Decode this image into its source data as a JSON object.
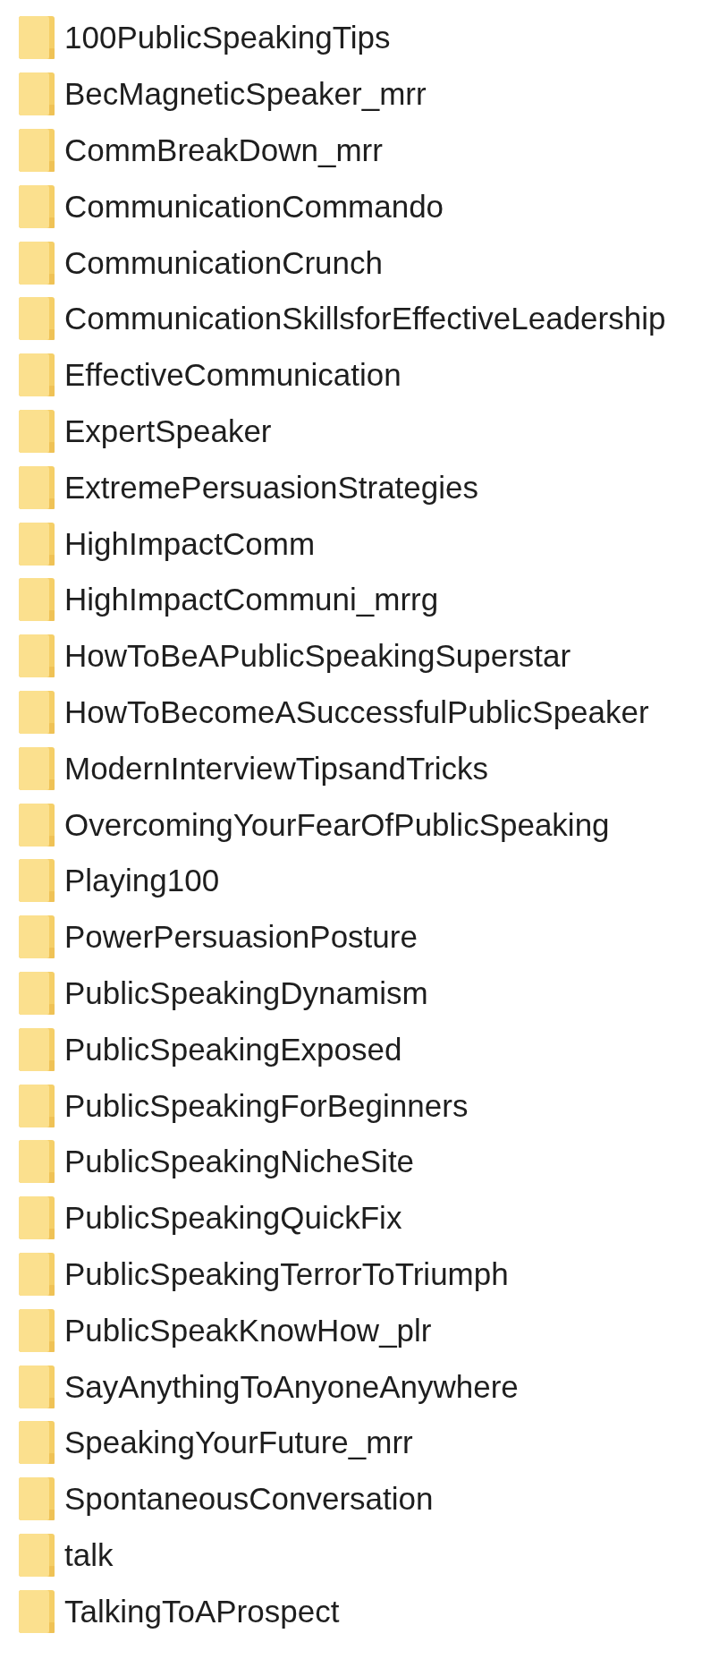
{
  "folders": [
    {
      "name": "100PublicSpeakingTips"
    },
    {
      "name": "BecMagneticSpeaker_mrr"
    },
    {
      "name": "CommBreakDown_mrr"
    },
    {
      "name": "CommunicationCommando"
    },
    {
      "name": "CommunicationCrunch"
    },
    {
      "name": "CommunicationSkillsforEffectiveLeadership"
    },
    {
      "name": "EffectiveCommunication"
    },
    {
      "name": "ExpertSpeaker"
    },
    {
      "name": "ExtremePersuasionStrategies"
    },
    {
      "name": "HighImpactComm"
    },
    {
      "name": "HighImpactCommuni_mrrg"
    },
    {
      "name": "HowToBeAPublicSpeakingSuperstar"
    },
    {
      "name": "HowToBecomeASuccessfulPublicSpeaker"
    },
    {
      "name": "ModernInterviewTipsandTricks"
    },
    {
      "name": "OvercomingYourFearOfPublicSpeaking"
    },
    {
      "name": "Playing100"
    },
    {
      "name": "PowerPersuasionPosture"
    },
    {
      "name": "PublicSpeakingDynamism"
    },
    {
      "name": "PublicSpeakingExposed"
    },
    {
      "name": "PublicSpeakingForBeginners"
    },
    {
      "name": "PublicSpeakingNicheSite"
    },
    {
      "name": "PublicSpeakingQuickFix"
    },
    {
      "name": "PublicSpeakingTerrorToTriumph"
    },
    {
      "name": "PublicSpeakKnowHow_plr"
    },
    {
      "name": "SayAnythingToAnyoneAnywhere"
    },
    {
      "name": "SpeakingYourFuture_mrr"
    },
    {
      "name": "SpontaneousConversation"
    },
    {
      "name": "talk"
    },
    {
      "name": "TalkingToAProspect"
    }
  ]
}
